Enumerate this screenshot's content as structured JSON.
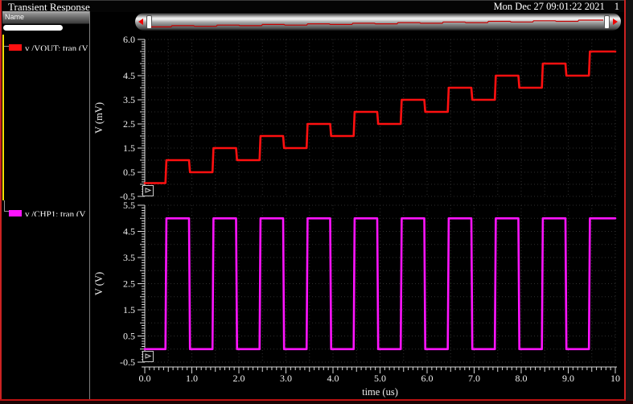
{
  "window": {
    "title": "Transient Response",
    "timestamp": "Mon Dec 27 09:01:22 2021",
    "page_indicator": "1"
  },
  "name_panel": {
    "header": "Name",
    "signals": [
      {
        "label": "v /VOUT; tran (V",
        "color": "#ff1010"
      },
      {
        "label": "v /CHP1; tran (V",
        "color": "#ff14ff"
      }
    ]
  },
  "colors": {
    "trace_red": "#ff1010",
    "trace_magenta": "#ff14ff",
    "mini_trace": "#c40000",
    "grid": "#2e2e2e",
    "ruler": "#d8d8d8",
    "frame_red": "#cc2222",
    "tree_yellow": "#ffdf00"
  },
  "chart_data": [
    {
      "type": "line",
      "name": "vout-transient",
      "xlabel": "",
      "ylabel": "V (mV)",
      "x_range": [
        0,
        10
      ],
      "y_range": [
        -0.5,
        6.0
      ],
      "grid": "dotted",
      "grid_step": 0.5,
      "tick_minor": 0.1,
      "y_ticks": [
        {
          "v": 6.0,
          "label": "6.0"
        },
        {
          "v": 4.5,
          "label": "4.5"
        },
        {
          "v": 3.5,
          "label": "3.5"
        },
        {
          "v": 2.5,
          "label": "2.5"
        },
        {
          "v": 1.5,
          "label": "1.5"
        },
        {
          "v": 0.5,
          "label": "0.5"
        },
        {
          "v": -0.5,
          "label": "-0.5"
        }
      ],
      "series": [
        {
          "name": "v /VOUT",
          "color": "#ff1010",
          "points": [
            [
              0,
              0.05
            ],
            [
              0.44,
              0.05
            ],
            [
              0.46,
              1.0
            ],
            [
              0.94,
              1.0
            ],
            [
              0.96,
              0.5
            ],
            [
              1.44,
              0.5
            ],
            [
              1.46,
              1.5
            ],
            [
              1.94,
              1.5
            ],
            [
              1.96,
              1.0
            ],
            [
              2.44,
              1.0
            ],
            [
              2.46,
              2.0
            ],
            [
              2.94,
              2.0
            ],
            [
              2.96,
              1.5
            ],
            [
              3.44,
              1.5
            ],
            [
              3.46,
              2.5
            ],
            [
              3.94,
              2.5
            ],
            [
              3.96,
              2.0
            ],
            [
              4.44,
              2.0
            ],
            [
              4.46,
              3.0
            ],
            [
              4.94,
              3.0
            ],
            [
              4.96,
              2.5
            ],
            [
              5.44,
              2.5
            ],
            [
              5.46,
              3.5
            ],
            [
              5.94,
              3.5
            ],
            [
              5.96,
              3.0
            ],
            [
              6.44,
              3.0
            ],
            [
              6.46,
              4.0
            ],
            [
              6.94,
              4.0
            ],
            [
              6.96,
              3.5
            ],
            [
              7.44,
              3.5
            ],
            [
              7.46,
              4.5
            ],
            [
              7.94,
              4.5
            ],
            [
              7.96,
              4.0
            ],
            [
              8.44,
              4.0
            ],
            [
              8.46,
              5.0
            ],
            [
              8.94,
              5.0
            ],
            [
              8.96,
              4.5
            ],
            [
              9.44,
              4.5
            ],
            [
              9.46,
              5.5
            ],
            [
              10,
              5.5
            ]
          ]
        }
      ]
    },
    {
      "type": "line",
      "name": "chp1-transient",
      "xlabel": "time (us)",
      "ylabel": "V (V)",
      "x_range": [
        0,
        10
      ],
      "y_range": [
        -0.5,
        5.5
      ],
      "grid": "dotted",
      "grid_step": 0.5,
      "tick_minor": 0.1,
      "y_ticks": [
        {
          "v": 5.5,
          "label": "5.5"
        },
        {
          "v": 4.5,
          "label": "4.5"
        },
        {
          "v": 3.5,
          "label": "3.5"
        },
        {
          "v": 2.5,
          "label": "2.5"
        },
        {
          "v": 1.5,
          "label": "1.5"
        },
        {
          "v": 0.5,
          "label": "0.5"
        },
        {
          "v": -0.5,
          "label": "-0.5"
        }
      ],
      "x_ticks": [
        {
          "v": 0,
          "label": "0.0"
        },
        {
          "v": 1,
          "label": "1.0"
        },
        {
          "v": 2,
          "label": "2.0"
        },
        {
          "v": 3,
          "label": "3.0"
        },
        {
          "v": 4,
          "label": "4.0"
        },
        {
          "v": 5,
          "label": "5.0"
        },
        {
          "v": 6,
          "label": "6.0"
        },
        {
          "v": 7,
          "label": "7.0"
        },
        {
          "v": 8,
          "label": "8.0"
        },
        {
          "v": 9,
          "label": "9.0"
        },
        {
          "v": 10,
          "label": "10"
        }
      ],
      "series": [
        {
          "name": "v /CHP1",
          "color": "#ff14ff",
          "points": [
            [
              0,
              0
            ],
            [
              0.44,
              0
            ],
            [
              0.46,
              5
            ],
            [
              0.94,
              5
            ],
            [
              0.96,
              0
            ],
            [
              1.44,
              0
            ],
            [
              1.46,
              5
            ],
            [
              1.94,
              5
            ],
            [
              1.96,
              0
            ],
            [
              2.44,
              0
            ],
            [
              2.46,
              5
            ],
            [
              2.94,
              5
            ],
            [
              2.96,
              0
            ],
            [
              3.44,
              0
            ],
            [
              3.46,
              5
            ],
            [
              3.94,
              5
            ],
            [
              3.96,
              0
            ],
            [
              4.44,
              0
            ],
            [
              4.46,
              5
            ],
            [
              4.94,
              5
            ],
            [
              4.96,
              0
            ],
            [
              5.44,
              0
            ],
            [
              5.46,
              5
            ],
            [
              5.94,
              5
            ],
            [
              5.96,
              0
            ],
            [
              6.44,
              0
            ],
            [
              6.46,
              5
            ],
            [
              6.94,
              5
            ],
            [
              6.96,
              0
            ],
            [
              7.44,
              0
            ],
            [
              7.46,
              5
            ],
            [
              7.94,
              5
            ],
            [
              7.96,
              0
            ],
            [
              8.44,
              0
            ],
            [
              8.46,
              5
            ],
            [
              8.94,
              5
            ],
            [
              8.96,
              0
            ],
            [
              9.44,
              0
            ],
            [
              9.46,
              5
            ],
            [
              10,
              5
            ]
          ]
        }
      ]
    }
  ]
}
